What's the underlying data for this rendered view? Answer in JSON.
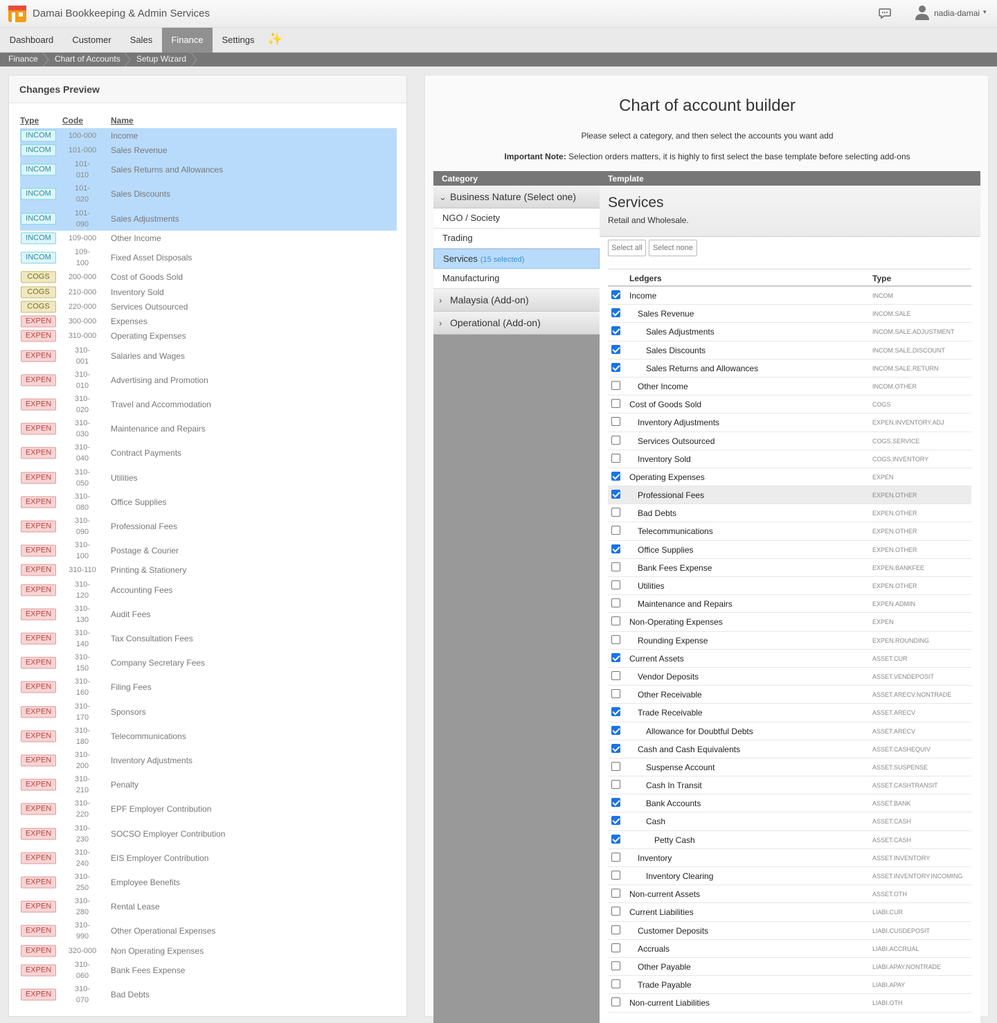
{
  "header": {
    "app_title": "Damai Bookkeeping & Admin Services",
    "user_name": "nadia-damai",
    "caret": "▾",
    "logo_icon": "shop-logo-icon",
    "chat_icon": "chat-bubble-icon",
    "user_icon": "user-avatar-icon"
  },
  "nav": {
    "items": [
      "Dashboard",
      "Customer",
      "Sales",
      "Finance",
      "Settings"
    ],
    "active": "Finance",
    "sparkle": "✨"
  },
  "breadcrumb": [
    "Finance",
    "Chart of Accounts",
    "Setup Wizard"
  ],
  "preview": {
    "title": "Changes Preview",
    "headers": {
      "type": "Type",
      "code": "Code",
      "name": "Name"
    },
    "rows": [
      {
        "type": "INCOM",
        "code": "100-000",
        "name": "Income",
        "sel": true
      },
      {
        "type": "INCOM",
        "code": "101-000",
        "name": "Sales Revenue",
        "sel": true
      },
      {
        "type": "INCOM",
        "code": "101-\n010",
        "name": "Sales Returns and Allowances",
        "sel": true
      },
      {
        "type": "INCOM",
        "code": "101-\n020",
        "name": "Sales Discounts",
        "sel": true
      },
      {
        "type": "INCOM",
        "code": "101-\n090",
        "name": "Sales Adjustments",
        "sel": true
      },
      {
        "type": "INCOM",
        "code": "109-000",
        "name": "Other Income",
        "sel": false
      },
      {
        "type": "INCOM",
        "code": "109-\n100",
        "name": "Fixed Asset Disposals",
        "sel": false
      },
      {
        "type": "COGS",
        "code": "200-000",
        "name": "Cost of Goods Sold",
        "sel": false
      },
      {
        "type": "COGS",
        "code": "210-000",
        "name": "Inventory Sold",
        "sel": false
      },
      {
        "type": "COGS",
        "code": "220-000",
        "name": "Services Outsourced",
        "sel": false
      },
      {
        "type": "EXPEN",
        "code": "300-000",
        "name": "Expenses",
        "sel": false
      },
      {
        "type": "EXPEN",
        "code": "310-000",
        "name": "Operating Expenses",
        "sel": false
      },
      {
        "type": "EXPEN",
        "code": "310-\n001",
        "name": "Salaries and Wages",
        "sel": false
      },
      {
        "type": "EXPEN",
        "code": "310-\n010",
        "name": "Advertising and Promotion",
        "sel": false
      },
      {
        "type": "EXPEN",
        "code": "310-\n020",
        "name": "Travel and Accommodation",
        "sel": false
      },
      {
        "type": "EXPEN",
        "code": "310-\n030",
        "name": "Maintenance and Repairs",
        "sel": false
      },
      {
        "type": "EXPEN",
        "code": "310-\n040",
        "name": "Contract Payments",
        "sel": false
      },
      {
        "type": "EXPEN",
        "code": "310-\n050",
        "name": "Utilities",
        "sel": false
      },
      {
        "type": "EXPEN",
        "code": "310-\n080",
        "name": "Office Supplies",
        "sel": false
      },
      {
        "type": "EXPEN",
        "code": "310-\n090",
        "name": "Professional Fees",
        "sel": false
      },
      {
        "type": "EXPEN",
        "code": "310-\n100",
        "name": "Postage & Courier",
        "sel": false
      },
      {
        "type": "EXPEN",
        "code": "310-110",
        "name": "Printing & Stationery",
        "sel": false
      },
      {
        "type": "EXPEN",
        "code": "310-\n120",
        "name": "Accounting Fees",
        "sel": false
      },
      {
        "type": "EXPEN",
        "code": "310-\n130",
        "name": "Audit Fees",
        "sel": false
      },
      {
        "type": "EXPEN",
        "code": "310-\n140",
        "name": "Tax Consultation Fees",
        "sel": false
      },
      {
        "type": "EXPEN",
        "code": "310-\n150",
        "name": "Company Secretary Fees",
        "sel": false
      },
      {
        "type": "EXPEN",
        "code": "310-\n160",
        "name": "Filing Fees",
        "sel": false
      },
      {
        "type": "EXPEN",
        "code": "310-\n170",
        "name": "Sponsors",
        "sel": false
      },
      {
        "type": "EXPEN",
        "code": "310-\n180",
        "name": "Telecommunications",
        "sel": false
      },
      {
        "type": "EXPEN",
        "code": "310-\n200",
        "name": "Inventory Adjustments",
        "sel": false
      },
      {
        "type": "EXPEN",
        "code": "310-\n210",
        "name": "Penalty",
        "sel": false
      },
      {
        "type": "EXPEN",
        "code": "310-\n220",
        "name": "EPF Employer Contribution",
        "sel": false
      },
      {
        "type": "EXPEN",
        "code": "310-\n230",
        "name": "SOCSO Employer Contribution",
        "sel": false
      },
      {
        "type": "EXPEN",
        "code": "310-\n240",
        "name": "EIS Employer Contribution",
        "sel": false
      },
      {
        "type": "EXPEN",
        "code": "310-\n250",
        "name": "Employee Benefits",
        "sel": false
      },
      {
        "type": "EXPEN",
        "code": "310-\n280",
        "name": "Rental Lease",
        "sel": false
      },
      {
        "type": "EXPEN",
        "code": "310-\n990",
        "name": "Other Operational Expenses",
        "sel": false
      },
      {
        "type": "EXPEN",
        "code": "320-000",
        "name": "Non Operating Expenses",
        "sel": false
      },
      {
        "type": "EXPEN",
        "code": "310-\n060",
        "name": "Bank Fees Expense",
        "sel": false
      },
      {
        "type": "EXPEN",
        "code": "310-\n070",
        "name": "Bad Debts",
        "sel": false
      }
    ]
  },
  "builder": {
    "title": "Chart of account builder",
    "subtitle": "Please select a category, and then select the accounts you want add",
    "note_label": "Important Note:",
    "note_text": " Selection orders matters, it is highly to first select the base template before selecting add-ons",
    "category_header": "Category",
    "template_header": "Template",
    "groups": {
      "business": "Business Nature (Select one)",
      "malaysia": "Malaysia (Add-on)",
      "operational": "Operational (Add-on)"
    },
    "categories": [
      {
        "label": "NGO / Society",
        "active": false,
        "count": ""
      },
      {
        "label": "Trading",
        "active": false,
        "count": ""
      },
      {
        "label": "Services",
        "active": true,
        "count": "(15 selected)"
      },
      {
        "label": "Manufacturing",
        "active": false,
        "count": ""
      }
    ],
    "template_name": "Services",
    "template_desc": "Retail and Wholesale.",
    "select_all": "Select all",
    "select_none": "Select none",
    "ledger_header": "Ledgers",
    "type_header": "Type",
    "ledgers": [
      {
        "name": "Income",
        "type": "INCOM",
        "level": 0,
        "checked": true
      },
      {
        "name": "Sales Revenue",
        "type": "INCOM.SALE",
        "level": 1,
        "checked": true
      },
      {
        "name": "Sales Adjustments",
        "type": "INCOM.SALE.ADJUSTMENT",
        "level": 2,
        "checked": true
      },
      {
        "name": "Sales Discounts",
        "type": "INCOM.SALE.DISCOUNT",
        "level": 2,
        "checked": true
      },
      {
        "name": "Sales Returns and Allowances",
        "type": "INCOM.SALE.RETURN",
        "level": 2,
        "checked": true
      },
      {
        "name": "Other Income",
        "type": "INCOM.OTHER",
        "level": 1,
        "checked": false
      },
      {
        "name": "Cost of Goods Sold",
        "type": "COGS",
        "level": 0,
        "checked": false
      },
      {
        "name": "Inventory Adjustments",
        "type": "EXPEN.INVENTORY.ADJ",
        "level": 1,
        "checked": false
      },
      {
        "name": "Services Outsourced",
        "type": "COGS.SERVICE",
        "level": 1,
        "checked": false
      },
      {
        "name": "Inventory Sold",
        "type": "COGS.INVENTORY",
        "level": 1,
        "checked": false
      },
      {
        "name": "Operating Expenses",
        "type": "EXPEN",
        "level": 0,
        "checked": true
      },
      {
        "name": "Professional Fees",
        "type": "EXPEN.OTHER",
        "level": 1,
        "checked": true,
        "hl": true
      },
      {
        "name": "Bad Debts",
        "type": "EXPEN.OTHER",
        "level": 1,
        "checked": false
      },
      {
        "name": "Telecommunications",
        "type": "EXPEN.OTHER",
        "level": 1,
        "checked": false
      },
      {
        "name": "Office Supplies",
        "type": "EXPEN.OTHER",
        "level": 1,
        "checked": true
      },
      {
        "name": "Bank Fees Expense",
        "type": "EXPEN.BANKFEE",
        "level": 1,
        "checked": false
      },
      {
        "name": "Utilities",
        "type": "EXPEN.OTHER",
        "level": 1,
        "checked": false
      },
      {
        "name": "Maintenance and Repairs",
        "type": "EXPEN.ADMIN",
        "level": 1,
        "checked": false
      },
      {
        "name": "Non-Operating Expenses",
        "type": "EXPEN",
        "level": 0,
        "checked": false
      },
      {
        "name": "Rounding Expense",
        "type": "EXPEN.ROUNDING",
        "level": 1,
        "checked": false
      },
      {
        "name": "Current Assets",
        "type": "ASSET.CUR",
        "level": 0,
        "checked": true
      },
      {
        "name": "Vendor Deposits",
        "type": "ASSET.VENDEPOSIT",
        "level": 1,
        "checked": false
      },
      {
        "name": "Other Receivable",
        "type": "ASSET.ARECV.NONTRADE",
        "level": 1,
        "checked": false
      },
      {
        "name": "Trade Receivable",
        "type": "ASSET.ARECV",
        "level": 1,
        "checked": true
      },
      {
        "name": "Allowance for Doubtful Debts",
        "type": "ASSET.ARECV",
        "level": 2,
        "checked": true
      },
      {
        "name": "Cash and Cash Equivalents",
        "type": "ASSET.CASHEQUIV",
        "level": 1,
        "checked": true
      },
      {
        "name": "Suspense Account",
        "type": "ASSET.SUSPENSE",
        "level": 2,
        "checked": false
      },
      {
        "name": "Cash In Transit",
        "type": "ASSET.CASHTRANSIT",
        "level": 2,
        "checked": false
      },
      {
        "name": "Bank Accounts",
        "type": "ASSET.BANK",
        "level": 2,
        "checked": true
      },
      {
        "name": "Cash",
        "type": "ASSET.CASH",
        "level": 2,
        "checked": true
      },
      {
        "name": "Petty Cash",
        "type": "ASSET.CASH",
        "level": 3,
        "checked": true
      },
      {
        "name": "Inventory",
        "type": "ASSET.INVENTORY",
        "level": 1,
        "checked": false
      },
      {
        "name": "Inventory Clearing",
        "type": "ASSET.INVENTORY.INCOMING",
        "level": 2,
        "checked": false
      },
      {
        "name": "Non-current Assets",
        "type": "ASSET.OTH",
        "level": 0,
        "checked": false
      },
      {
        "name": "Current Liabilities",
        "type": "LIABI.CUR",
        "level": 0,
        "checked": false
      },
      {
        "name": "Customer Deposits",
        "type": "LIABI.CUSDEPOSIT",
        "level": 1,
        "checked": false
      },
      {
        "name": "Accruals",
        "type": "LIABI.ACCRUAL",
        "level": 1,
        "checked": false
      },
      {
        "name": "Other Payable",
        "type": "LIABI.APAY.NONTRADE",
        "level": 1,
        "checked": false
      },
      {
        "name": "Trade Payable",
        "type": "LIABI.APAY",
        "level": 1,
        "checked": false
      },
      {
        "name": "Non-current Liabilities",
        "type": "LIABI.OTH",
        "level": 0,
        "checked": false
      }
    ]
  }
}
